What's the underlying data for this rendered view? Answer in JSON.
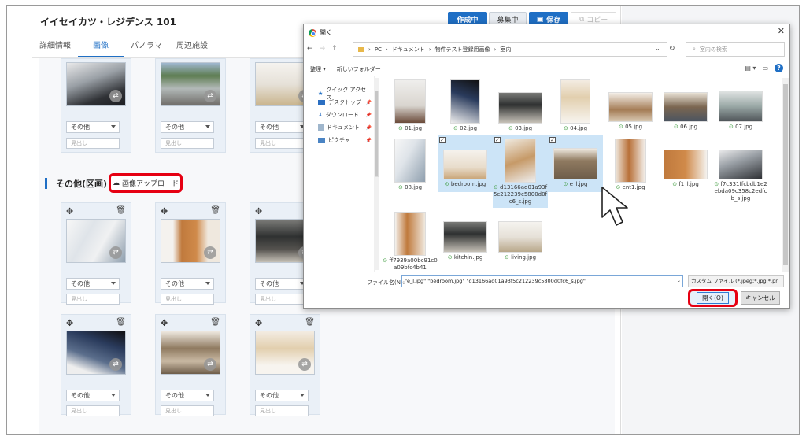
{
  "header": {
    "title": "イイセイカツ・レジデンス 101",
    "btn_creating": "作成中",
    "btn_editing": "募集中",
    "btn_save": "保存",
    "btn_copy": "コピー"
  },
  "tabs": [
    "詳細情報",
    "画像",
    "パノラマ",
    "周辺施設"
  ],
  "cards": {
    "select_value": "その他",
    "caption_placeholder": "見出し"
  },
  "section": {
    "title": "その他(区画)",
    "upload_label": "画像アップロード"
  },
  "dialog": {
    "title": "開く",
    "address": [
      "PC",
      "ドキュメント",
      "物件テスト登録用画像",
      "室内"
    ],
    "search_placeholder": "室内の検索",
    "organize": "整理 ▾",
    "new_folder": "新しいフォルダー",
    "sidebar": [
      "クイック アクセス",
      "デスクトップ",
      "ダウンロード",
      "ドキュメント",
      "ピクチャ"
    ],
    "files": [
      {
        "name": "01.jpg",
        "selected": false
      },
      {
        "name": "02.jpg",
        "selected": false
      },
      {
        "name": "03.jpg",
        "selected": false
      },
      {
        "name": "04.jpg",
        "selected": false
      },
      {
        "name": "05.jpg",
        "selected": false
      },
      {
        "name": "06.jpg",
        "selected": false
      },
      {
        "name": "07.jpg",
        "selected": false
      },
      {
        "name": "08.jpg",
        "selected": false
      },
      {
        "name": "bedroom.jpg",
        "selected": true
      },
      {
        "name": "d13166ad01a93f5c212239c5800d0fc6_s.jpg",
        "selected": true
      },
      {
        "name": "e_l.jpg",
        "selected": true
      },
      {
        "name": "ent1.jpg",
        "selected": false
      },
      {
        "name": "f1_l.jpg",
        "selected": false
      },
      {
        "name": "f7c331ffcbdb1e2ebda09c358c2edfcb_s.jpg",
        "selected": false
      },
      {
        "name": "ff7939a00bc91c0a09bfc4b41",
        "selected": false
      },
      {
        "name": "kitchin.jpg",
        "selected": false
      },
      {
        "name": "living.jpg",
        "selected": false
      }
    ],
    "filename_label": "ファイル名(N):",
    "filename_value": "\"e_l.jpg\" \"bedroom.jpg\" \"d13166ad01a93f5c212239c5800d0fc6_s.jpg\"",
    "filter": "カスタム ファイル (*.jpeg;*.jpg;*.pn",
    "open": "開く(O)",
    "cancel": "キャンセル"
  },
  "colors": {
    "accent": "#1f6fc5",
    "highlight": "#e60012",
    "selection": "#cce4f7"
  }
}
